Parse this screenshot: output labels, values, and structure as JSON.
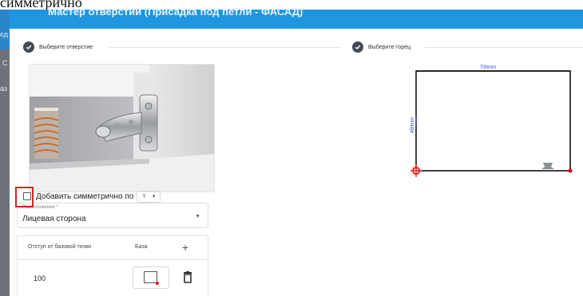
{
  "page": {
    "top_fragment": "симметрично"
  },
  "background_app": {
    "letters": [
      "ед",
      "С",
      "аз"
    ]
  },
  "dialog": {
    "title": "Мастер отверстий (Присадка под петли - ФАСАД)"
  },
  "steps": {
    "left_label": "Выберите отверстие",
    "right_label": "Выберите торец"
  },
  "options": {
    "symmetric_label": "Добавить симметрично по",
    "symmetric_checked": false,
    "axis_value": "Y"
  },
  "location": {
    "caption": "Расположение *",
    "value": "Лицевая сторона"
  },
  "table": {
    "columns": [
      "Отступ от базовой точки",
      "База"
    ],
    "add_symbol": "+",
    "rows": [
      {
        "offset": "100"
      }
    ]
  },
  "drawing": {
    "width_label": "700mm",
    "height_label": "450mm"
  },
  "colors": {
    "header_blue": "#1e96e0",
    "highlight_red": "#e01f1f",
    "dimension_blue": "#2c3ccf",
    "marker_red": "#e00000"
  },
  "icons": [
    "check-icon",
    "chevron-down-icon",
    "plus-icon",
    "trash-icon",
    "hinge-icon",
    "origin-marker-icon"
  ]
}
